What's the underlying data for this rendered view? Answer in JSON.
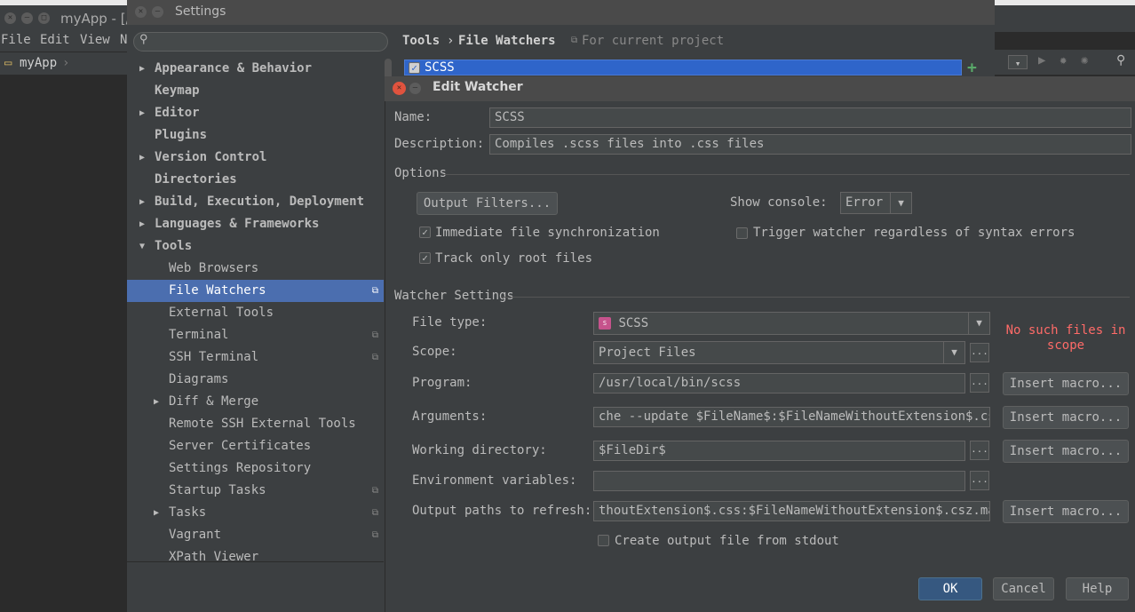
{
  "app": {
    "title": "myApp - [/",
    "menu": [
      "File",
      "Edit",
      "View",
      "N"
    ],
    "project": "myApp"
  },
  "settings": {
    "title": "Settings",
    "search_placeholder": "",
    "breadcrumb_root": "Tools",
    "breadcrumb_sep": "›",
    "breadcrumb_page": "File Watchers",
    "scope_note": "For current project",
    "watcher_row": "SCSS",
    "add_symbol": "+",
    "tree": [
      {
        "label": "Appearance & Behavior",
        "bold": true,
        "arrow": "▶",
        "level": 0
      },
      {
        "label": "Keymap",
        "bold": true,
        "arrow": "",
        "level": 0
      },
      {
        "label": "Editor",
        "bold": true,
        "arrow": "▶",
        "level": 0
      },
      {
        "label": "Plugins",
        "bold": true,
        "arrow": "",
        "level": 0
      },
      {
        "label": "Version Control",
        "bold": true,
        "arrow": "▶",
        "level": 0
      },
      {
        "label": "Directories",
        "bold": true,
        "arrow": "",
        "level": 0
      },
      {
        "label": "Build, Execution, Deployment",
        "bold": true,
        "arrow": "▶",
        "level": 0
      },
      {
        "label": "Languages & Frameworks",
        "bold": true,
        "arrow": "▶",
        "level": 0
      },
      {
        "label": "Tools",
        "bold": true,
        "arrow": "▼",
        "level": 0
      },
      {
        "label": "Web Browsers",
        "bold": false,
        "arrow": "",
        "level": 1
      },
      {
        "label": "File Watchers",
        "bold": false,
        "arrow": "",
        "level": 1,
        "selected": true,
        "proj": true
      },
      {
        "label": "External Tools",
        "bold": false,
        "arrow": "",
        "level": 1
      },
      {
        "label": "Terminal",
        "bold": false,
        "arrow": "",
        "level": 1,
        "proj": true
      },
      {
        "label": "SSH Terminal",
        "bold": false,
        "arrow": "",
        "level": 1,
        "proj": true
      },
      {
        "label": "Diagrams",
        "bold": false,
        "arrow": "",
        "level": 1
      },
      {
        "label": "Diff & Merge",
        "bold": false,
        "arrow": "▶",
        "level": 1
      },
      {
        "label": "Remote SSH External Tools",
        "bold": false,
        "arrow": "",
        "level": 1
      },
      {
        "label": "Server Certificates",
        "bold": false,
        "arrow": "",
        "level": 1
      },
      {
        "label": "Settings Repository",
        "bold": false,
        "arrow": "",
        "level": 1
      },
      {
        "label": "Startup Tasks",
        "bold": false,
        "arrow": "",
        "level": 1,
        "proj": true
      },
      {
        "label": "Tasks",
        "bold": false,
        "arrow": "▶",
        "level": 1,
        "proj": true
      },
      {
        "label": "Vagrant",
        "bold": false,
        "arrow": "",
        "level": 1,
        "proj": true
      },
      {
        "label": "XPath Viewer",
        "bold": false,
        "arrow": "",
        "level": 1
      }
    ]
  },
  "edit_watcher": {
    "title": "Edit Watcher",
    "name_label": "Name:",
    "name_value": "SCSS",
    "description_label": "Description:",
    "description_value": "Compiles .scss files into .css files",
    "options_heading": "Options",
    "output_filters_btn": "Output Filters...",
    "show_console_label": "Show console:",
    "show_console_value": "Error",
    "immediate_sync_label": "Immediate file synchronization",
    "immediate_sync_checked": true,
    "trigger_label": "Trigger watcher regardless of syntax errors",
    "trigger_checked": false,
    "track_root_label": "Track only root files",
    "track_root_checked": true,
    "watcher_settings_heading": "Watcher Settings",
    "file_type_label": "File type:",
    "file_type_value": "SCSS",
    "scope_label": "Scope:",
    "scope_value": "Project Files",
    "no_files_msg": "No such files in scope",
    "program_label": "Program:",
    "program_value": "/usr/local/bin/scss",
    "arguments_label": "Arguments:",
    "arguments_value": "che --update $FileName$:$FileNameWithoutExtension$.css",
    "working_dir_label": "Working directory:",
    "working_dir_value": "$FileDir$",
    "env_label": "Environment variables:",
    "env_value": "",
    "output_paths_label": "Output paths to refresh:",
    "output_paths_value": "thoutExtension$.css:$FileNameWithoutExtension$.csz.map",
    "create_output_label": "Create output file from stdout",
    "create_output_checked": false,
    "insert_macro": "Insert macro...",
    "ellipsis": "...",
    "ok": "OK",
    "cancel": "Cancel",
    "help": "Help"
  },
  "colors": {
    "background": "#2b2b2b",
    "panel": "#3c3f41",
    "selection": "#4b6eaf",
    "default_button": "#365880",
    "error_text": "#ff6b68"
  }
}
